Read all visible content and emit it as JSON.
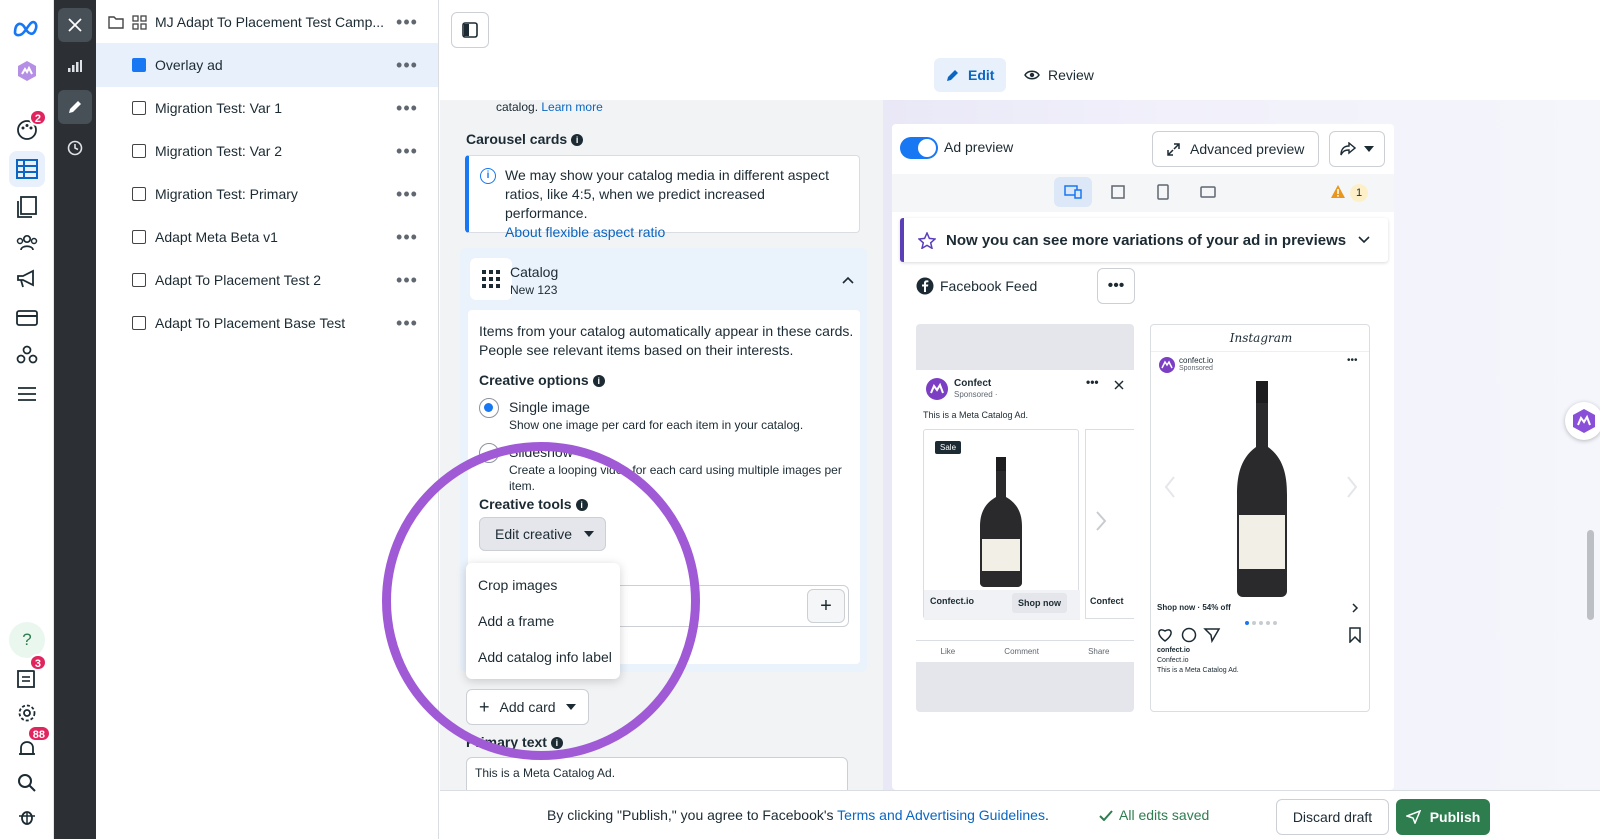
{
  "tree": {
    "items": [
      {
        "label": "MJ Adapt To Placement Test Camp..."
      },
      {
        "label": "Overlay ad"
      },
      {
        "label": "Migration Test: Var 1"
      },
      {
        "label": "Migration Test: Var 2"
      },
      {
        "label": "Migration Test: Primary"
      },
      {
        "label": "Adapt Meta Beta v1"
      },
      {
        "label": "Adapt To Placement Test 2"
      },
      {
        "label": "Adapt To Placement Base Test"
      }
    ]
  },
  "rail": {
    "badges": {
      "notifications_top": "2",
      "reports": "3",
      "alerts": "88"
    }
  },
  "modes": {
    "edit": "Edit",
    "review": "Review"
  },
  "form": {
    "catalog_note": "catalog.",
    "learn_more": "Learn more",
    "carousel_title": "Carousel cards",
    "notice_text": "We may show your catalog media in different aspect ratios, like 4:5, when we predict increased performance.",
    "notice_link": "About flexible aspect ratio",
    "catalog_title": "Catalog",
    "catalog_sub": "New 123",
    "catalog_desc": "Items from your catalog automatically appear in these cards. People see relevant items based on their interests.",
    "creative_options": "Creative options",
    "single_image": "Single image",
    "single_image_sub": "Show one image per card for each item in your catalog.",
    "slideshow": "Slideshow",
    "slideshow_sub": "Create a looping video for each card using multiple images per item.",
    "creative_tools": "Creative tools",
    "edit_creative": "Edit creative",
    "menu": [
      "Crop images",
      "Add a frame",
      "Add catalog info label"
    ],
    "add_card": "Add card",
    "primary_text": "Primary text",
    "primary_value": "This is a Meta Catalog Ad."
  },
  "preview": {
    "toggle_label": "Ad preview",
    "advanced": "Advanced preview",
    "warning_count": "1",
    "variations": "Now you can see more variations of your ad in previews",
    "placement": "Facebook Feed",
    "fb": {
      "brand": "Confect",
      "sponsored": "Sponsored · ",
      "caption": "This is a Meta Catalog Ad.",
      "sale": "Sale",
      "card_name": "Confect.io",
      "card_name2": "Confect",
      "shop_now": "Shop now",
      "like": "Like",
      "comment": "Comment",
      "share": "Share"
    },
    "ig": {
      "logo": "Instagram",
      "handle": "confect.io",
      "sponsored": "Sponsored",
      "shop_now": "Shop now · 54% off",
      "user": "confect.io",
      "brand": "Confect.io",
      "caption": "This is a Meta Catalog Ad."
    }
  },
  "bottom": {
    "agree_prefix": "By clicking \"Publish,\" you agree to Facebook's ",
    "agree_link": "Terms and Advertising Guidelines",
    "agree_suffix": ".",
    "saved": "All edits saved",
    "discard": "Discard draft",
    "publish": "Publish"
  },
  "colors": {
    "accent": "#1877f2",
    "highlight": "#a05ad6",
    "publish": "#2e7d4f",
    "badge": "#e0245e"
  }
}
